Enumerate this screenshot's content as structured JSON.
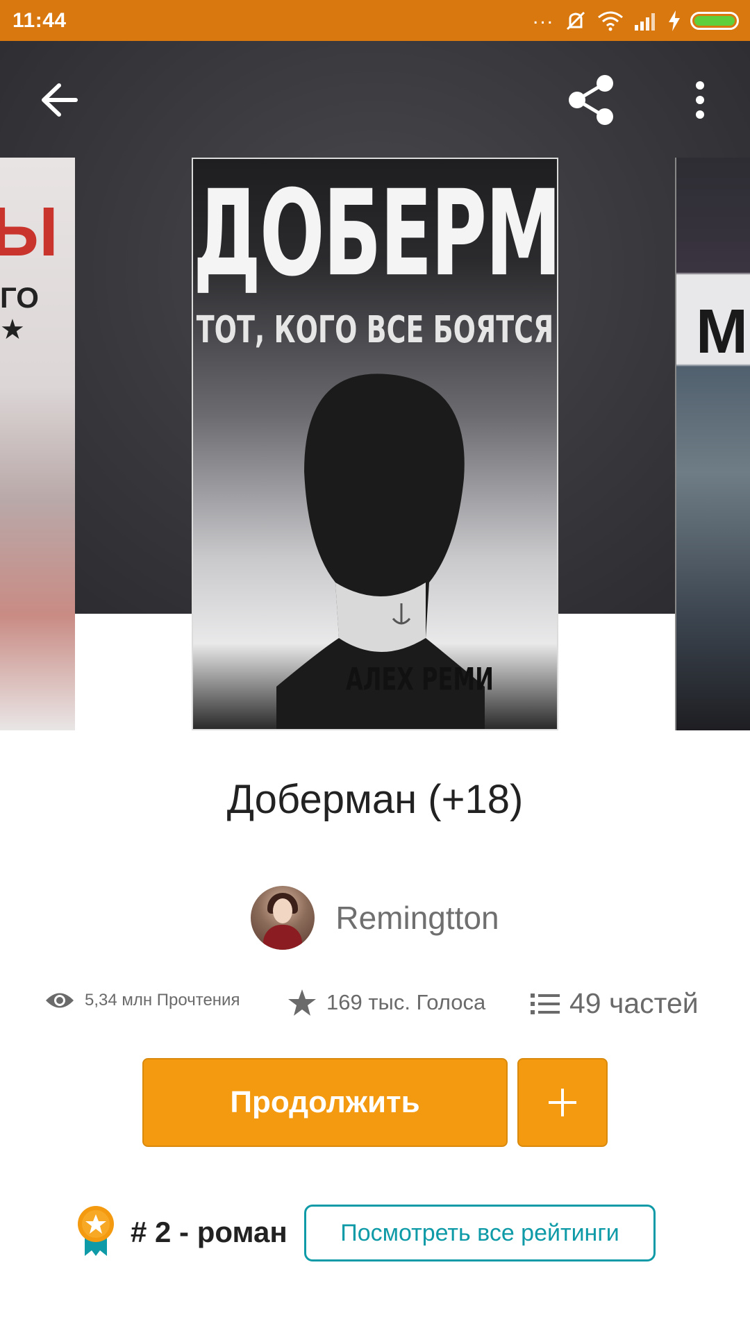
{
  "status_bar": {
    "time": "11:44",
    "more": "...",
    "battery_fill": 1.0,
    "accent": "#d9780f"
  },
  "toolbar": {
    "icons": [
      "arrow-left-icon",
      "share-icon",
      "more-vertical-icon"
    ]
  },
  "covers": {
    "main": {
      "title": "ДОБЕРМАН",
      "subtitle": "ТОТ, КОГО ВСЕ БОЯТСЯ",
      "author": "АЛЕХ РЕМИ"
    },
    "left_partial": {
      "text1": "Ы",
      "text2": "ГО",
      "text3": "★"
    },
    "right_partial": {
      "text1": "M"
    }
  },
  "book": {
    "title": "Доберман (+18)"
  },
  "author": {
    "name": "Remingtton"
  },
  "stats": {
    "reads": "5,34 млн Прочтения",
    "votes": "169 тыс. Голоса",
    "parts": "49 частей"
  },
  "actions": {
    "continue_label": "Продолжить",
    "add_label": "+",
    "primary_color": "#f39a10"
  },
  "ranking": {
    "text": "# 2 - роман",
    "view_all_label": "Посмотреть все рейтинги",
    "link_color": "#0e9aa7"
  }
}
